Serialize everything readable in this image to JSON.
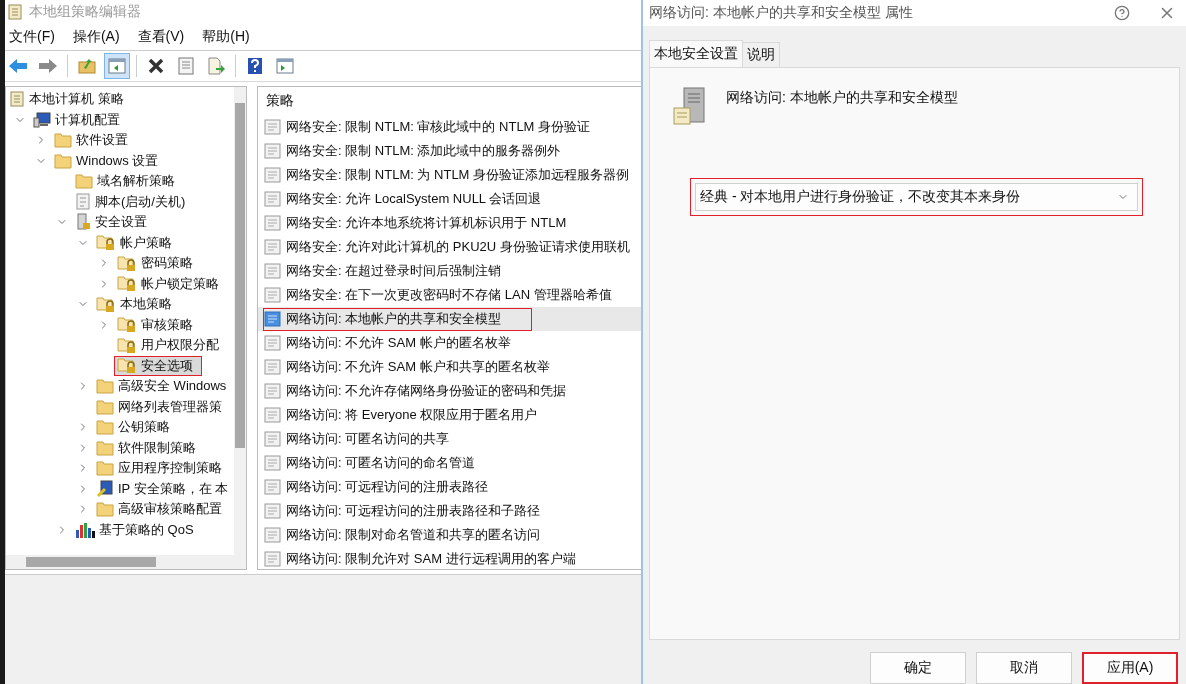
{
  "editor": {
    "title": "本地组策略编辑器",
    "menu": [
      "文件(F)",
      "操作(A)",
      "查看(V)",
      "帮助(H)"
    ],
    "toolbar": [
      {
        "kind": "back",
        "pressed": false
      },
      {
        "kind": "forward",
        "pressed": false
      },
      {
        "kind": "separator"
      },
      {
        "kind": "up",
        "pressed": false
      },
      {
        "kind": "tree",
        "pressed": true
      },
      {
        "kind": "separator"
      },
      {
        "kind": "delete",
        "pressed": false
      },
      {
        "kind": "properties",
        "pressed": false
      },
      {
        "kind": "export",
        "pressed": false
      },
      {
        "kind": "separator"
      },
      {
        "kind": "help",
        "pressed": false
      },
      {
        "kind": "pane",
        "pressed": false
      }
    ],
    "tree": [
      {
        "label": "本地计算机 策略",
        "kind": "scroll",
        "selected": false,
        "highlighted": false,
        "children": [
          {
            "label": "计算机配置",
            "kind": "computer",
            "expanded": true,
            "selected": false,
            "highlighted": false,
            "children": [
              {
                "label": "软件设置",
                "kind": "folder",
                "expanded": false,
                "selected": false,
                "highlighted": false
              },
              {
                "label": "Windows 设置",
                "kind": "folder",
                "expanded": true,
                "selected": false,
                "highlighted": false,
                "children": [
                  {
                    "label": "域名解析策略",
                    "kind": "folder",
                    "selected": false,
                    "highlighted": false
                  },
                  {
                    "label": "脚本(启动/关机)",
                    "kind": "script",
                    "selected": false,
                    "highlighted": false
                  },
                  {
                    "label": "安全设置",
                    "kind": "security",
                    "expanded": true,
                    "selected": false,
                    "highlighted": false,
                    "children": [
                      {
                        "label": "帐户策略",
                        "kind": "lockfolder",
                        "expanded": true,
                        "selected": false,
                        "highlighted": false,
                        "children": [
                          {
                            "label": "密码策略",
                            "kind": "lockfolder",
                            "expanded": false,
                            "selected": false,
                            "highlighted": false
                          },
                          {
                            "label": "帐户锁定策略",
                            "kind": "lockfolder",
                            "expanded": false,
                            "selected": false,
                            "highlighted": false
                          }
                        ]
                      },
                      {
                        "label": "本地策略",
                        "kind": "lockfolder",
                        "expanded": true,
                        "selected": false,
                        "highlighted": false,
                        "children": [
                          {
                            "label": "审核策略",
                            "kind": "lockfolder",
                            "expanded": false,
                            "selected": false,
                            "highlighted": false
                          },
                          {
                            "label": "用户权限分配",
                            "kind": "lockfolder",
                            "selected": false,
                            "highlighted": false
                          },
                          {
                            "label": "安全选项",
                            "kind": "lockfolder",
                            "selected": true,
                            "highlighted": true
                          }
                        ]
                      },
                      {
                        "label": "高级安全 Windows",
                        "kind": "folder",
                        "expanded": false,
                        "selected": false,
                        "highlighted": false
                      },
                      {
                        "label": "网络列表管理器策",
                        "kind": "folder",
                        "selected": false,
                        "highlighted": false
                      },
                      {
                        "label": "公钥策略",
                        "kind": "folder",
                        "expanded": false,
                        "selected": false,
                        "highlighted": false
                      },
                      {
                        "label": "软件限制策略",
                        "kind": "folder",
                        "expanded": false,
                        "selected": false,
                        "highlighted": false
                      },
                      {
                        "label": "应用程序控制策略",
                        "kind": "folder",
                        "expanded": false,
                        "selected": false,
                        "highlighted": false
                      },
                      {
                        "label": "IP 安全策略，在 本",
                        "kind": "ip",
                        "expanded": false,
                        "selected": false,
                        "highlighted": false
                      },
                      {
                        "label": "高级审核策略配置",
                        "kind": "folder",
                        "expanded": false,
                        "selected": false,
                        "highlighted": false
                      }
                    ]
                  },
                  {
                    "label": "基于策略的 QoS",
                    "kind": "chart",
                    "expanded": false,
                    "selected": false,
                    "highlighted": false
                  }
                ]
              }
            ]
          }
        ]
      }
    ],
    "list": {
      "column": "策略",
      "rows": [
        {
          "label": "网络安全: 限制 NTLM: 审核此域中的 NTLM 身份验证",
          "selected": false,
          "highlighted": false
        },
        {
          "label": "网络安全: 限制 NTLM: 添加此域中的服务器例外",
          "selected": false,
          "highlighted": false
        },
        {
          "label": "网络安全: 限制 NTLM: 为 NTLM 身份验证添加远程服务器例",
          "selected": false,
          "highlighted": false
        },
        {
          "label": "网络安全: 允许 LocalSystem NULL 会话回退",
          "selected": false,
          "highlighted": false
        },
        {
          "label": "网络安全: 允许本地系统将计算机标识用于 NTLM",
          "selected": false,
          "highlighted": false
        },
        {
          "label": "网络安全: 允许对此计算机的 PKU2U 身份验证请求使用联机",
          "selected": false,
          "highlighted": false
        },
        {
          "label": "网络安全: 在超过登录时间后强制注销",
          "selected": false,
          "highlighted": false
        },
        {
          "label": "网络安全: 在下一次更改密码时不存储 LAN 管理器哈希值",
          "selected": false,
          "highlighted": false
        },
        {
          "label": "网络访问: 本地帐户的共享和安全模型",
          "selected": true,
          "highlighted": true
        },
        {
          "label": "网络访问: 不允许 SAM 帐户的匿名枚举",
          "selected": false,
          "highlighted": false
        },
        {
          "label": "网络访问: 不允许 SAM 帐户和共享的匿名枚举",
          "selected": false,
          "highlighted": false
        },
        {
          "label": "网络访问: 不允许存储网络身份验证的密码和凭据",
          "selected": false,
          "highlighted": false
        },
        {
          "label": "网络访问: 将 Everyone 权限应用于匿名用户",
          "selected": false,
          "highlighted": false
        },
        {
          "label": "网络访问: 可匿名访问的共享",
          "selected": false,
          "highlighted": false
        },
        {
          "label": "网络访问: 可匿名访问的命名管道",
          "selected": false,
          "highlighted": false
        },
        {
          "label": "网络访问: 可远程访问的注册表路径",
          "selected": false,
          "highlighted": false
        },
        {
          "label": "网络访问: 可远程访问的注册表路径和子路径",
          "selected": false,
          "highlighted": false
        },
        {
          "label": "网络访问: 限制对命名管道和共享的匿名访问",
          "selected": false,
          "highlighted": false
        },
        {
          "label": "网络访问: 限制允许对 SAM 进行远程调用的客户端",
          "selected": false,
          "highlighted": false
        }
      ]
    }
  },
  "dialog": {
    "title": "网络访问: 本地帐户的共享和安全模型 属性",
    "tabs": [
      {
        "label": "本地安全设置",
        "selected": true
      },
      {
        "label": "说明",
        "selected": false
      }
    ],
    "policy_name": "网络访问: 本地帐户的共享和安全模型",
    "dropdown": {
      "value": "经典 - 对本地用户进行身份验证，不改变其本来身份",
      "highlighted": true
    },
    "buttons": [
      {
        "label": "确定",
        "highlighted": false
      },
      {
        "label": "取消",
        "highlighted": false
      },
      {
        "label": "应用(A)",
        "highlighted": true
      }
    ]
  }
}
